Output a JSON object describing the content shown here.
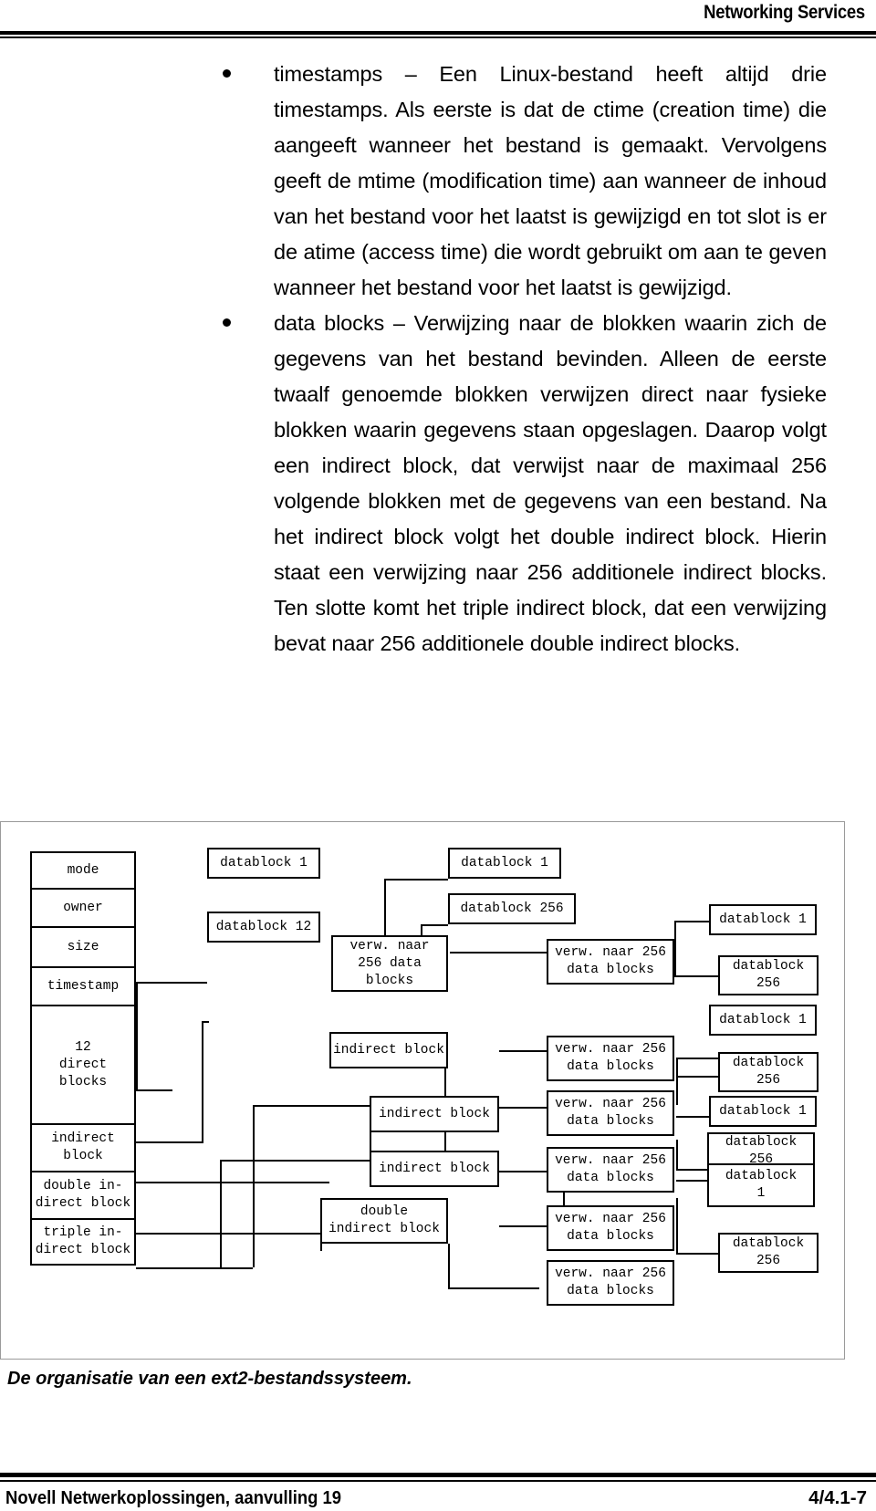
{
  "header": {
    "title": "Networking Services"
  },
  "content": {
    "bullets": [
      {
        "text": "timestamps – Een Linux-bestand heeft altijd drie timestamps. Als eerste is dat de ctime (creation time) die aangeeft wanneer het bestand is gemaakt. Vervolgens geeft de mtime (modification time) aan wanneer de inhoud van het bestand voor het laatst is gewijzigd en tot slot is er de atime (access time) die wordt gebruikt om aan te geven wanneer het bestand voor het laatst is gewijzigd."
      },
      {
        "text": "data blocks – Verwijzing naar de blokken waarin zich de gegevens van het bestand bevinden. Alleen de eerste twaalf genoemde blokken verwijzen direct naar fysieke blokken waarin gegevens staan opgeslagen. Daarop volgt een indirect block, dat verwijst naar de maximaal 256 volgende blokken met de gegevens van een bestand. Na het indirect block volgt het double indirect block. Hierin staat een verwijzing naar 256 additionele indirect blocks. Ten slotte komt het triple indirect block, dat een verwijzing bevat naar 256 additionele double indirect blocks."
      }
    ]
  },
  "figure": {
    "caption": "De organisatie van een ext2-bestandssysteem.",
    "inode_fields": [
      "mode",
      "owner",
      "size",
      "timestamp",
      "12\ndirect\nblocks",
      "indirect\nblock",
      "double in-\ndirect block",
      "triple in-\ndirect block"
    ],
    "direct_datablocks": [
      "datablock 1",
      "datablock 12"
    ],
    "indirect_level": {
      "pointer_box": "verw. naar\n256 data\nblocks",
      "datablocks": [
        "datablock 1",
        "datablock 256"
      ]
    },
    "indirect_blocks": [
      "indirect block",
      "indirect block",
      "indirect block"
    ],
    "double_indirect_block": "double\nindirect block",
    "pointer_boxes": [
      "verw. naar 256\ndata blocks",
      "verw. naar 256\ndata blocks",
      "verw. naar 256\ndata blocks",
      "verw. naar 256\ndata blocks",
      "verw. naar 256\ndata blocks",
      "verw. naar 256\ndata blocks"
    ],
    "right_datablocks": [
      "datablock 1",
      "datablock\n256",
      "datablock 1",
      "datablock\n256",
      "datablock 1",
      "datablock\n256",
      "datablock\n1",
      "datablock\n256"
    ]
  },
  "footer": {
    "left": "Novell Netwerkoplossingen, aanvulling 19",
    "right": "4/4.1-7"
  }
}
